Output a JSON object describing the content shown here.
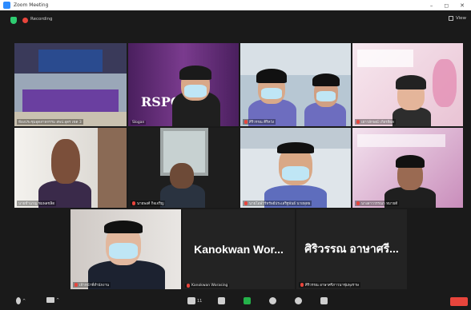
{
  "window": {
    "title": "Zoom Meeting",
    "controls": [
      "–",
      "◻",
      "✕"
    ]
  },
  "meeting": {
    "recording_label": "Recording",
    "view_label": "View"
  },
  "tiles": [
    {
      "name": "ห้องประชุมอุตสาหกรรม สพป.อุดร เขต 3",
      "muted": false,
      "kind": "room"
    },
    {
      "name": "Slogan",
      "muted": false,
      "kind": "banner",
      "banner_text": "RSPOCAU"
    },
    {
      "name": "ศิริวรรณ ศิริหวัง",
      "muted": true,
      "kind": "two"
    },
    {
      "name": "เยาวลักษณ์ เกียรติผล",
      "muted": true,
      "kind": "slide_person"
    },
    {
      "name": "นายชำนาญ ชมพลชลิต",
      "muted": false,
      "kind": "person"
    },
    {
      "name": "นายพงศ์ กิจเจริญ",
      "muted": true,
      "kind": "person_dark"
    },
    {
      "name": "นายโอฬาร์ทรัพย์ประเสริฐพันธ์ นายพุทธ",
      "muted": true,
      "kind": "person_mask"
    },
    {
      "name": "นางสาววรรณา หมายดี",
      "muted": true,
      "kind": "slide_person2"
    },
    {
      "name": "เจ้าหน้าที่สำนักงาน",
      "muted": true,
      "kind": "person_mask2"
    },
    {
      "name": "Kanokwan Worasing",
      "muted": true,
      "kind": "text",
      "display": "Kanokwan  Wor..."
    },
    {
      "name": "ศิริวรรณ อาษาศรีภาวนาชุ่มพุงราษ",
      "muted": true,
      "kind": "text",
      "display": "ศิริวรรณ อาษาศรี..."
    }
  ],
  "toolbar": {
    "participants_count": "11"
  }
}
